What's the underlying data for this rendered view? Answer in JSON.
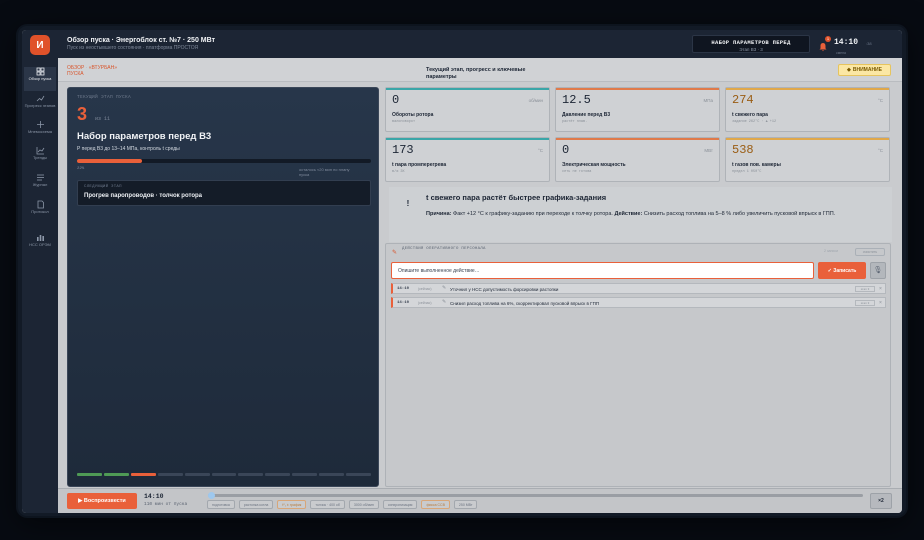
{
  "app": {
    "logo_letter": "И"
  },
  "rail": [
    {
      "label": "Обзор пуска",
      "icon": "grid-icon",
      "active": true
    },
    {
      "label": "Прогресс этапов",
      "icon": "chart-up-icon"
    },
    {
      "label": "Мнемосхема",
      "icon": "crosshair-icon"
    },
    {
      "label": "Тренды",
      "icon": "trend-icon"
    },
    {
      "label": "Журнал",
      "icon": "list-icon"
    },
    {
      "label": "Протокол",
      "icon": "document-icon"
    },
    {
      "label": "НСС ОРЭМ",
      "icon": "bars-icon"
    }
  ],
  "header": {
    "title": "Обзор пуска · Энергоблок ст. №7 · 250 МВт",
    "subtitle": "Пуск из неостывшего состояния · платформа ПРОСТОЯ",
    "stage_box": {
      "line1": "НАБОР ПАРАМЕТРОВ ПЕРЕД",
      "line2": "Этап В3 · 3"
    },
    "notif_count": "1",
    "clock": "14:10",
    "clock_sec": ":38",
    "clock_date": "смена"
  },
  "crumbs": {
    "a": "ОБЗОР",
    "sep": "·",
    "b": "«ВТУРБАН»",
    "c": "ПУСКА"
  },
  "center_title": "Текущий этап, прогресс и ключевые параметры",
  "attention": {
    "icon": "◆",
    "label": "ВНИМАНИЕ"
  },
  "stage": {
    "kicker": "ТЕКУЩИЙ ЭТАП ПУСКА",
    "number": "3",
    "of": "из 11",
    "title": "Набор параметров перед В3",
    "desc": "P перед В3 до 13–14 МПа, контроль t среды",
    "progress": 0.22,
    "progress_label": "22%",
    "progress_right": "осталось ≈20 мин по плану пуска",
    "next_kicker": "СЛЕДУЮЩИЙ ЭТАП",
    "next_title": "Прогрев паропроводов · толчок ротора",
    "segments": [
      "done",
      "done",
      "cur",
      "todo",
      "todo",
      "todo",
      "todo",
      "todo",
      "todo",
      "todo",
      "todo"
    ]
  },
  "cards": [
    {
      "value": "0",
      "unit": "об/мин",
      "label": "Обороты ротора",
      "sub": "валоповорот",
      "accent": "#3aa6a8",
      "hot": false
    },
    {
      "value": "12.5",
      "unit": "МПа",
      "label": "Давление перед В3",
      "sub": "растёт плав.",
      "accent": "#e07a4a",
      "hot": false
    },
    {
      "value": "274",
      "unit": "°C",
      "label": "t свежего пара",
      "sub": "задание 262°C · ▲ +12",
      "accent": "#e0a84a",
      "hot": true
    },
    {
      "value": "173",
      "unit": "°C",
      "label": "t пара промперегрева",
      "sub": "в/ж 3К",
      "accent": "#3aa6a8",
      "hot": false
    },
    {
      "value": "0",
      "unit": "МВт",
      "label": "Электрическая мощность",
      "sub": "сеть не готова",
      "accent": "#e07a4a",
      "hot": false
    },
    {
      "value": "538",
      "unit": "°C",
      "label": "t газов пов. камеры",
      "sub": "предел 1 050°C",
      "accent": "#e0a84a",
      "hot": true
    }
  ],
  "alert": {
    "icon": "!",
    "title": "t свежего пара растёт быстрее графика-задания",
    "cause_label": "Причина:",
    "cause": " Факт +12 °C к графику-заданию при переходе к толчку ротора.",
    "action_label": "Действие:",
    "action": " Снизить расход топлива на 5–8 % либо увеличить пусковой впрыск в ГПП."
  },
  "actions": {
    "kicker": "ДЕЙСТВИЯ ОПЕРАТИВНОГО ПЕРСОНАЛА",
    "link": "2 записи",
    "clear": "очистить",
    "placeholder": "Опишите выполненное действие…",
    "submit": "✓ Записать",
    "entries": [
      {
        "time": "14:10",
        "ago": "(сейчас)",
        "text": "Уточнил у НСС допустимость форсировки растопки",
        "tag": "этап 3"
      },
      {
        "time": "14:10",
        "ago": "(сейчас)",
        "text": "Снизил расход топлива на 6%, скорректировал пусковой впрыск в ГПП",
        "tag": "этап 3"
      }
    ]
  },
  "bottom": {
    "play": "▶ Воспроизвести",
    "time": "14:10",
    "since": "110 мин от пуска",
    "progress": 0.0,
    "chips": [
      {
        "text": "подготовка",
        "hot": false
      },
      {
        "text": "растопка котла",
        "hot": false
      },
      {
        "text": "t⁰₁ ± график",
        "hot": true
      },
      {
        "text": "толчок · 400 об",
        "hot": false
      },
      {
        "text": "3000 об/мин",
        "hot": false
      },
      {
        "text": "синхронизация",
        "hot": false
      },
      {
        "text": "фикса ССВ",
        "hot": true
      },
      {
        "text": "250 МВт",
        "hot": false
      }
    ],
    "speed": "×2"
  }
}
